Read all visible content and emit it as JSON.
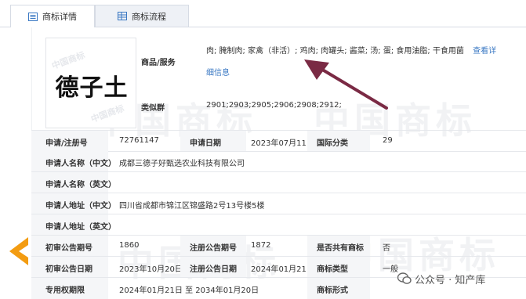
{
  "tabs": [
    {
      "label": "商标详情",
      "active": true,
      "icon": "list-doc-icon"
    },
    {
      "label": "商标流程",
      "active": false,
      "icon": "grid-table-icon"
    }
  ],
  "logo": {
    "text": "德子土",
    "seal_text": "中国商标"
  },
  "goods": {
    "label": "商品/服务",
    "value": "肉; 腌制肉; 家禽（非活）; 鸡肉; 肉罐头; 酱菜; 汤; 蛋; 食用油脂; 干食用菌",
    "link_label_1": "查看详",
    "link_label_2": "细信息"
  },
  "similar_group": {
    "label": "类似群",
    "value": "2901;2903;2905;2906;2908;2912;"
  },
  "rows": {
    "reg_no_label": "申请/注册号",
    "reg_no": "72761147",
    "apply_date_label": "申请日期",
    "apply_date": "2023年07月11日",
    "intl_class_label": "国际分类",
    "intl_class": "29",
    "applicant_cn_label": "申请人名称（中文）",
    "applicant_cn": "成都三德子好甄选农业科技有限公司",
    "applicant_en_label": "申请人名称（英文）",
    "address_cn_label": "申请人地址（中文）",
    "address_cn": "四川省成都市锦江区锦盛路2号13号楼5楼",
    "address_en_label": "申请人地址（英文）",
    "prelim_no_label": "初审公告期号",
    "prelim_no": "1860",
    "reg_pub_no_label": "注册公告期号",
    "reg_pub_no": "1872",
    "shared_label": "是否共有商标",
    "shared": "否",
    "prelim_date_label": "初审公告日期",
    "prelim_date": "2023年10月20日",
    "reg_pub_date_label": "注册公告日期",
    "reg_pub_date": "2024年01月21日",
    "mark_type_label": "商标类型",
    "mark_type": "一般",
    "exclusive_label": "专用权期限",
    "exclusive": "2024年01月21日 至 2034年01月20日",
    "mark_form_label": "商标形式"
  },
  "brand": {
    "text": "公众号 · 知产库"
  },
  "colors": {
    "annotation_arrow": "#7a2a44",
    "side_arrow": "#f39c12",
    "link": "#3a78c3"
  }
}
